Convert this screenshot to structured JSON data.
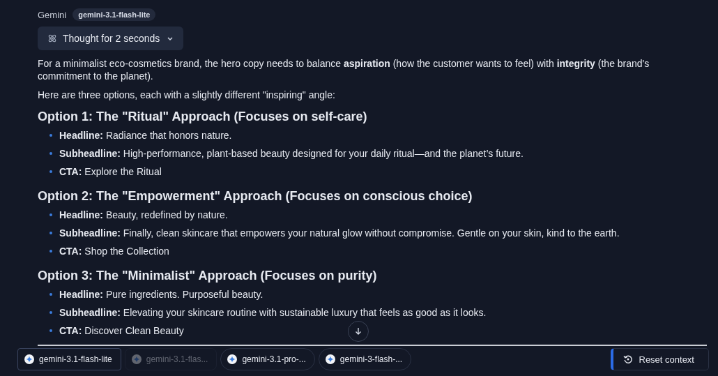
{
  "header": {
    "sender": "Gemini",
    "model_badge": "gemini-3.1-flash-lite"
  },
  "thought": {
    "label": "Thought for 2 seconds",
    "expanded": false
  },
  "intro": [
    "For a minimalist eco-cosmetics brand, the hero copy needs to balance **aspiration** (how the customer wants to feel) with **integrity** (the brand's commitment to the planet).",
    "Here are three options, each with a slightly different \"inspiring\" angle:"
  ],
  "options": [
    {
      "heading": "Option 1: The \"Ritual\" Approach (Focuses on self-care)",
      "items": [
        {
          "label": "Headline:",
          "text": "Radiance that honors nature."
        },
        {
          "label": "Subheadline:",
          "text": "High-performance, plant-based beauty designed for your daily ritual—and the planet’s future."
        },
        {
          "label": "CTA:",
          "text": "Explore the Ritual"
        }
      ]
    },
    {
      "heading": "Option 2: The \"Empowerment\" Approach (Focuses on conscious choice)",
      "items": [
        {
          "label": "Headline:",
          "text": "Beauty, redefined by nature."
        },
        {
          "label": "Subheadline:",
          "text": "Finally, clean skincare that empowers your natural glow without compromise. Gentle on your skin, kind to the earth."
        },
        {
          "label": "CTA:",
          "text": "Shop the Collection"
        }
      ]
    },
    {
      "heading": "Option 3: The \"Minimalist\" Approach (Focuses on purity)",
      "items": [
        {
          "label": "Headline:",
          "text": "Pure ingredients. Purposeful beauty."
        },
        {
          "label": "Subheadline:",
          "text": "Elevating your skincare routine with sustainable luxury that feels as good as it looks."
        },
        {
          "label": "CTA:",
          "text": "Discover Clean Beauty"
        }
      ]
    }
  ],
  "model_chips": [
    {
      "label": "gemini-3.1-flash-lite",
      "selected": true,
      "disabled": false
    },
    {
      "label": "gemini-3.1-flas...",
      "selected": false,
      "disabled": true
    },
    {
      "label": "gemini-3.1-pro-...",
      "selected": false,
      "disabled": false
    },
    {
      "label": "gemini-3-flash-...",
      "selected": false,
      "disabled": false
    }
  ],
  "reset_button": {
    "label": "Reset context"
  }
}
